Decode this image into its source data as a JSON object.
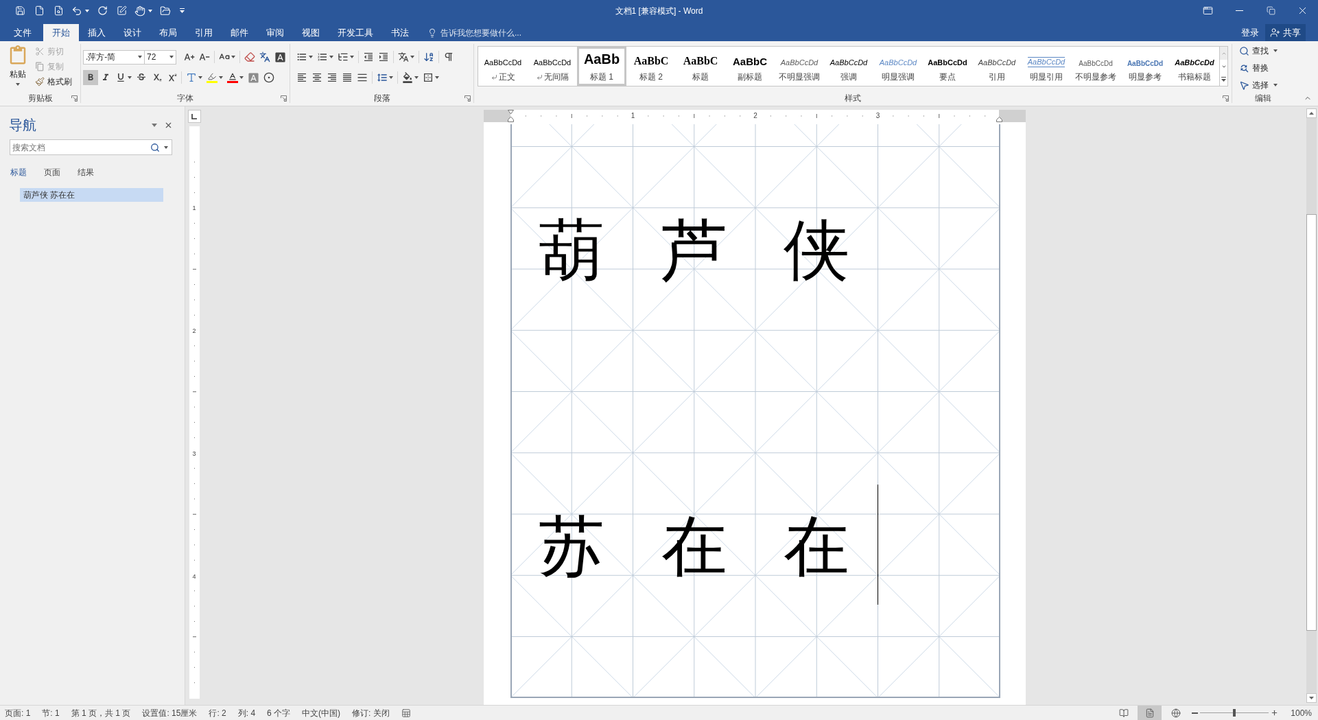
{
  "window": {
    "title": "文档1 [兼容模式] - Word"
  },
  "ribbon_tabs": [
    {
      "label": "文件",
      "selected": false
    },
    {
      "label": "开始",
      "selected": true
    },
    {
      "label": "插入",
      "selected": false
    },
    {
      "label": "设计",
      "selected": false
    },
    {
      "label": "布局",
      "selected": false
    },
    {
      "label": "引用",
      "selected": false
    },
    {
      "label": "邮件",
      "selected": false
    },
    {
      "label": "审阅",
      "selected": false
    },
    {
      "label": "视图",
      "selected": false
    },
    {
      "label": "开发工具",
      "selected": false
    },
    {
      "label": "书法",
      "selected": false
    }
  ],
  "tell_me": {
    "placeholder": "告诉我您想要做什么..."
  },
  "account": {
    "sign_in": "登录",
    "share": "共享"
  },
  "ribbon": {
    "clipboard": {
      "paste": "粘贴",
      "items": [
        {
          "label": "剪切",
          "disabled": true
        },
        {
          "label": "复制",
          "disabled": true
        },
        {
          "label": "格式刷",
          "disabled": false
        }
      ],
      "label": "剪贴板"
    },
    "font": {
      "font_name": ".萍方-简",
      "font_size": "72",
      "format_buttons": [
        {
          "on": true
        },
        {
          "on": false
        },
        {
          "on": false
        },
        {
          "on": false
        },
        {
          "on": false
        },
        {
          "on": false
        }
      ],
      "label": "字体"
    },
    "paragraph": {
      "label": "段落"
    },
    "styles": {
      "items": [
        {
          "kind": "normal",
          "preview": "AaBbCcDd",
          "name": "正文",
          "paragraph_mark": true,
          "selected": false
        },
        {
          "kind": "normal",
          "preview": "AaBbCcDd",
          "name": "无间隔",
          "paragraph_mark": true,
          "selected": false
        },
        {
          "kind": "heading1",
          "preview": "AaBb",
          "name": "标题 1",
          "paragraph_mark": false,
          "selected": true
        },
        {
          "kind": "heading2",
          "preview": "AaBbC",
          "name": "标题 2",
          "paragraph_mark": false,
          "selected": false
        },
        {
          "kind": "title",
          "preview": "AaBbC",
          "name": "标题",
          "paragraph_mark": false,
          "selected": false
        },
        {
          "kind": "subtitle",
          "preview": "AaBbC",
          "name": "副标题",
          "paragraph_mark": false,
          "selected": false
        },
        {
          "kind": "subtle_emphasis",
          "preview": "AaBbCcDd",
          "name": "不明显强调",
          "paragraph_mark": false,
          "selected": false
        },
        {
          "kind": "emphasis",
          "preview": "AaBbCcDd",
          "name": "强调",
          "paragraph_mark": false,
          "selected": false
        },
        {
          "kind": "intense_emphasis",
          "preview": "AaBbCcDd",
          "name": "明显强调",
          "paragraph_mark": false,
          "selected": false
        },
        {
          "kind": "strong",
          "preview": "AaBbCcDd",
          "name": "要点",
          "paragraph_mark": false,
          "selected": false
        },
        {
          "kind": "quote",
          "preview": "AaBbCcDd",
          "name": "引用",
          "paragraph_mark": false,
          "selected": false
        },
        {
          "kind": "intense_quote",
          "preview": "AaBbCcDd",
          "name": "明显引用",
          "paragraph_mark": false,
          "selected": false
        },
        {
          "kind": "subtle_reference",
          "preview": "AaBbCcDd",
          "name": "不明显参考",
          "paragraph_mark": false,
          "selected": false
        },
        {
          "kind": "intense_reference",
          "preview": "AaBbCcDd",
          "name": "明显参考",
          "paragraph_mark": false,
          "selected": false
        },
        {
          "kind": "book_title",
          "preview": "AaBbCcDd",
          "name": "书籍标题",
          "paragraph_mark": false,
          "selected": false
        }
      ],
      "label": "样式"
    },
    "editing": {
      "items": [
        {
          "label": "查找",
          "dropdown": true
        },
        {
          "label": "替换",
          "dropdown": false
        },
        {
          "label": "选择",
          "dropdown": true
        }
      ],
      "label": "编辑"
    }
  },
  "navigation": {
    "title": "导航",
    "search": {
      "placeholder": "搜索文档"
    },
    "tabs": [
      {
        "label": "标题",
        "selected": true
      },
      {
        "label": "页面",
        "selected": false
      },
      {
        "label": "结果",
        "selected": false
      }
    ],
    "headings": [
      {
        "text": "葫芦侠 苏在在",
        "selected": true
      }
    ]
  },
  "rulers": {
    "horizontal": [
      "1",
      "2",
      "3"
    ],
    "vertical": [
      "1",
      "2",
      "3",
      "4"
    ]
  },
  "document": {
    "lines": [
      [
        "葫",
        "芦",
        "侠"
      ],
      [
        "苏",
        "在",
        "在"
      ]
    ]
  },
  "status_bar": {
    "items": [
      "页面: 1",
      "节: 1",
      "第 1 页，共 1 页",
      "设置值: 15厘米",
      "行: 2",
      "列: 4",
      "6 个字",
      "中文(中国)",
      "修订: 关闭"
    ],
    "views": [
      {
        "selected": false
      },
      {
        "selected": true
      },
      {
        "selected": false
      }
    ],
    "zoom": {
      "level": 0.5,
      "reading": "100%"
    }
  }
}
